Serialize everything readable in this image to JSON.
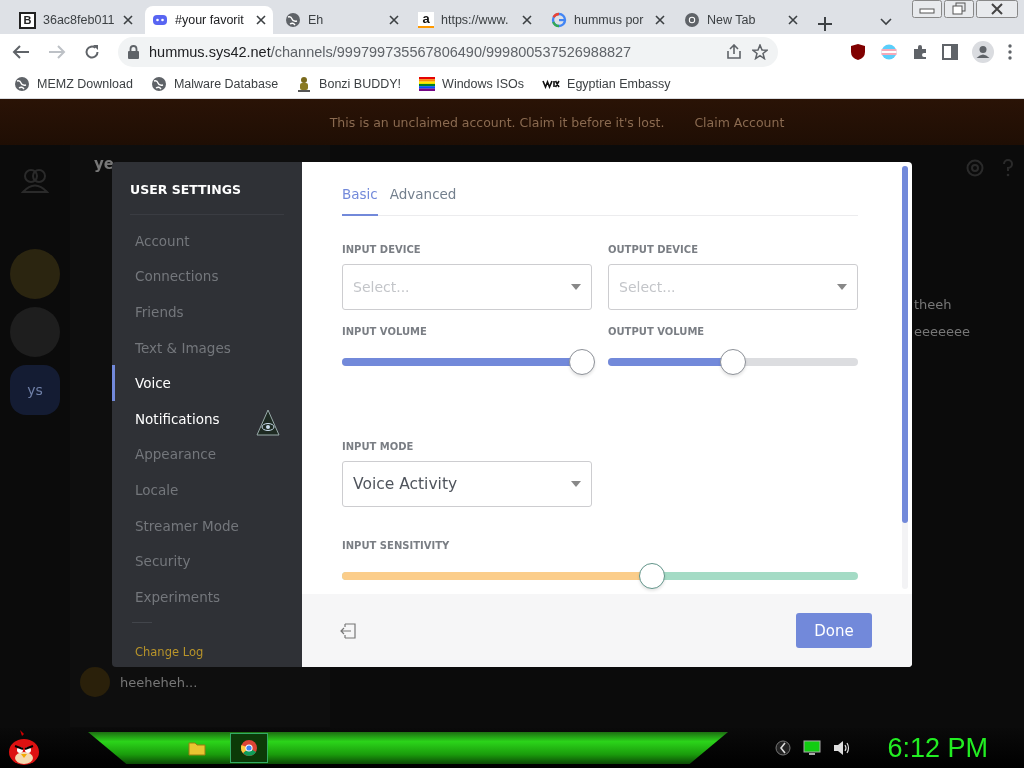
{
  "browser": {
    "tabs": [
      {
        "title": "36ac8feb011",
        "kind": "letter",
        "icon_text": "B",
        "selected": false
      },
      {
        "title": "#your favorit",
        "kind": "discord",
        "selected": true
      },
      {
        "title": "Eh",
        "kind": "globe",
        "selected": false
      },
      {
        "title": "https://www.",
        "kind": "amazon",
        "icon_text": "a",
        "selected": false
      },
      {
        "title": "hummus por",
        "kind": "google",
        "selected": false
      },
      {
        "title": "New Tab",
        "kind": "chrome",
        "selected": false
      }
    ],
    "address": {
      "host": "hummus.sys42.net",
      "path": "/channels/999799735567806490/999800537526988827"
    },
    "bookmarks": [
      {
        "label": "MEMZ Download",
        "kind": "globe"
      },
      {
        "label": "Malware Database",
        "kind": "globe"
      },
      {
        "label": "Bonzi BUDDY!",
        "kind": "bonzi"
      },
      {
        "label": "Windows ISOs",
        "kind": "rainbow"
      },
      {
        "label": "Egyptian Embassy",
        "kind": "wix"
      }
    ]
  },
  "banner": {
    "text": "This is an unclaimed account. Claim it before it's lost.",
    "action": "Claim Account"
  },
  "background": {
    "channel_title": "ye",
    "server_initials": "ys",
    "messages": [
      "theeh",
      "eeeeeee"
    ],
    "user_name": "heeheheh..."
  },
  "settings": {
    "title": "USER SETTINGS",
    "nav": [
      {
        "label": "Account",
        "kind": "item",
        "selected": false,
        "hovered": false
      },
      {
        "label": "Connections",
        "kind": "item",
        "selected": false,
        "hovered": false
      },
      {
        "label": "Friends",
        "kind": "item",
        "selected": false,
        "hovered": false
      },
      {
        "label": "Text & Images",
        "kind": "item",
        "selected": false,
        "hovered": false
      },
      {
        "label": "Voice",
        "kind": "item",
        "selected": true,
        "hovered": false
      },
      {
        "label": "Notifications",
        "kind": "item",
        "selected": false,
        "hovered": true
      },
      {
        "label": "Appearance",
        "kind": "item",
        "selected": false,
        "hovered": false
      },
      {
        "label": "Locale",
        "kind": "item",
        "selected": false,
        "hovered": false
      },
      {
        "label": "Streamer Mode",
        "kind": "item",
        "selected": false,
        "hovered": false
      },
      {
        "label": "Security",
        "kind": "item",
        "selected": false,
        "hovered": false
      },
      {
        "label": "Experiments",
        "kind": "item",
        "selected": false,
        "hovered": false
      },
      {
        "label": "Change Log",
        "kind": "link",
        "selected": false,
        "hovered": false
      }
    ],
    "tabs": [
      {
        "label": "Basic",
        "selected": true
      },
      {
        "label": "Advanced",
        "selected": false
      }
    ],
    "input_device": {
      "label": "INPUT DEVICE",
      "placeholder": "Select..."
    },
    "output_device": {
      "label": "OUTPUT DEVICE",
      "placeholder": "Select..."
    },
    "input_volume": {
      "label": "INPUT VOLUME",
      "level": 0.96
    },
    "output_volume": {
      "label": "OUTPUT VOLUME",
      "level": 0.5
    },
    "input_mode": {
      "label": "INPUT MODE",
      "value": "Voice Activity"
    },
    "input_sensitivity": {
      "label": "INPUT SENSITIVITY",
      "level": 0.6
    },
    "done": "Done"
  },
  "taskbar": {
    "apps": [
      {
        "kind": "folder",
        "selected": false
      },
      {
        "kind": "chrome",
        "selected": true
      }
    ],
    "clock": "6:12 PM"
  }
}
